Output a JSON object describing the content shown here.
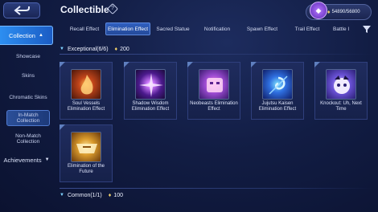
{
  "header": {
    "title": "Collectible",
    "help_icon": "help-diamond-icon",
    "currency_value": "54890/56800",
    "currency_icon": "coin-icon"
  },
  "sidebar": {
    "collection_label": "Collection",
    "items": [
      {
        "label": "Showcase"
      },
      {
        "label": "Skins"
      },
      {
        "label": "Chromatic Skins"
      },
      {
        "label": "In-Match Collection"
      },
      {
        "label": "Non-Match Collection"
      }
    ],
    "achievements_label": "Achievements"
  },
  "tabs": [
    {
      "label": "Recall Effect"
    },
    {
      "label": "Elimination Effect"
    },
    {
      "label": "Sacred Statue"
    },
    {
      "label": "Notification"
    },
    {
      "label": "Spawn Effect"
    },
    {
      "label": "Trail Effect"
    },
    {
      "label": "Battle I"
    }
  ],
  "sections": [
    {
      "label": "Exceptional(6/6)",
      "points": "200"
    },
    {
      "label": "Common(1/1)",
      "points": "100"
    }
  ],
  "cards": [
    {
      "name": "Soul Vessels Elimination Effect",
      "color": "#8a3a14"
    },
    {
      "name": "Shadow Wisdom Elimination Effect",
      "color": "#3a1a6e"
    },
    {
      "name": "Neobeasts Elimination Effect",
      "color": "#6e3f9a"
    },
    {
      "name": "Jujutsu Kaisen Elimination Effect",
      "color": "#1f3ea8"
    },
    {
      "name": "Knockout: Uh, Next Time",
      "color": "#5f4ac2"
    },
    {
      "name": "Elimination of the Future",
      "color": "#b07420"
    }
  ],
  "colors": {
    "accent": "#2d8ef1",
    "gold": "#f4d36b"
  }
}
